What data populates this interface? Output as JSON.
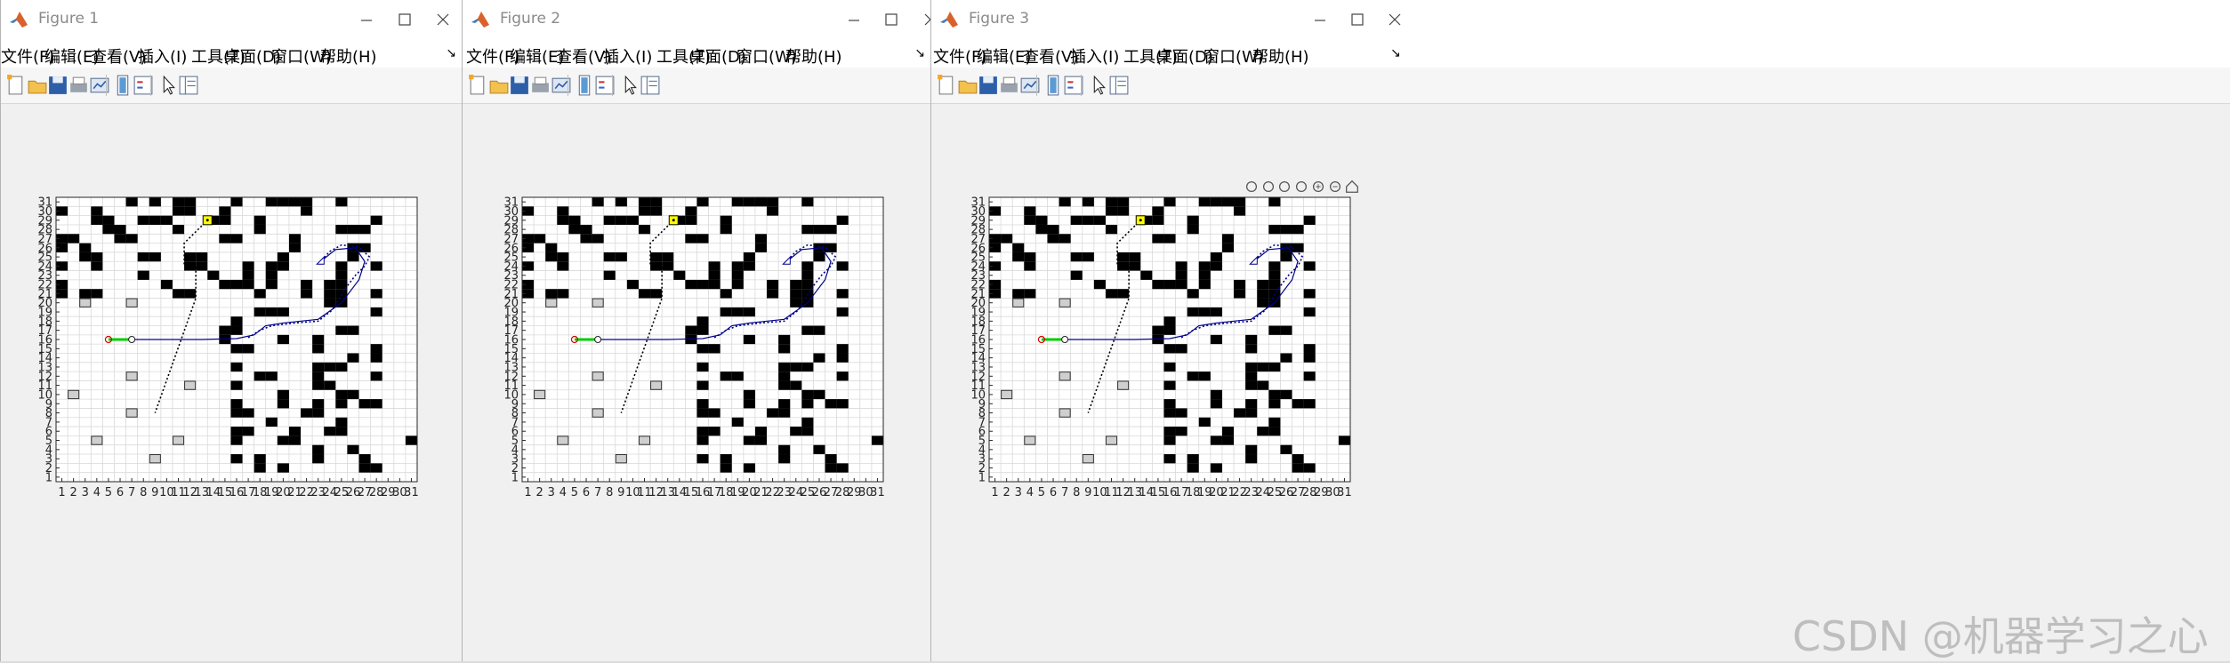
{
  "windows": [
    {
      "title": "Figure 1",
      "show_axes_toolbar": false
    },
    {
      "title": "Figure 2",
      "show_axes_toolbar": false
    },
    {
      "title": "Figure 3",
      "show_axes_toolbar": true
    }
  ],
  "menu": [
    "文件(F)",
    "编辑(E)",
    "查看(V)",
    "插入(I)",
    "工具(T)",
    "桌面(D)",
    "窗口(W)",
    "帮助(H)"
  ],
  "toolbar_icons": [
    "new-figure-icon",
    "open-file-icon",
    "save-icon",
    "print-icon",
    "link-plot-icon",
    "colorbar-icon",
    "legend-icon",
    "edit-plot-icon",
    "property-inspector-icon"
  ],
  "axes_toolbar_icons": [
    "brush-icon",
    "data-tips-icon",
    "export-icon",
    "pan-icon",
    "zoom-in-icon",
    "zoom-out-icon",
    "home-icon"
  ],
  "watermark": "CSDN @机器学习之心",
  "colors": {
    "obstacle": "#000000",
    "grid": "#d9d9d9",
    "gray_obstacle": "#cfcfcf",
    "path": "#000000",
    "trajectory": "#00008b",
    "start_arrow": "#00cc00",
    "goal_box": "#ffff00"
  },
  "chart_data": {
    "type": "grid-map",
    "x_ticks": [
      "1",
      "2",
      "3",
      "4",
      "5",
      "6",
      "7",
      "8",
      "9",
      "10",
      "11",
      "12",
      "13",
      "14",
      "15",
      "16",
      "17",
      "18",
      "19",
      "20",
      "21",
      "22",
      "23",
      "24",
      "25",
      "26",
      "27",
      "28",
      "29",
      "30",
      "31"
    ],
    "y_ticks": [
      "1",
      "2",
      "3",
      "4",
      "5",
      "6",
      "7",
      "8",
      "9",
      "10",
      "11",
      "12",
      "13",
      "14",
      "15",
      "16",
      "17",
      "18",
      "19",
      "20",
      "21",
      "22",
      "23",
      "24",
      "25",
      "26",
      "27",
      "28",
      "29",
      "30",
      "31"
    ],
    "xlim": [
      0.5,
      31.5
    ],
    "ylim": [
      0.5,
      31.5
    ],
    "grid": true,
    "obstacles": [
      [
        7,
        31
      ],
      [
        9,
        31
      ],
      [
        11,
        31
      ],
      [
        12,
        31
      ],
      [
        16,
        31
      ],
      [
        19,
        31
      ],
      [
        20,
        31
      ],
      [
        21,
        31
      ],
      [
        22,
        31
      ],
      [
        25,
        31
      ],
      [
        1,
        30
      ],
      [
        4,
        30
      ],
      [
        11,
        30
      ],
      [
        12,
        30
      ],
      [
        15,
        30
      ],
      [
        22,
        30
      ],
      [
        4,
        29
      ],
      [
        5,
        29
      ],
      [
        8,
        29
      ],
      [
        9,
        29
      ],
      [
        10,
        29
      ],
      [
        14,
        29
      ],
      [
        15,
        29
      ],
      [
        18,
        29
      ],
      [
        28,
        29
      ],
      [
        5,
        28
      ],
      [
        6,
        28
      ],
      [
        11,
        28
      ],
      [
        18,
        28
      ],
      [
        25,
        28
      ],
      [
        26,
        28
      ],
      [
        27,
        28
      ],
      [
        1,
        27
      ],
      [
        2,
        27
      ],
      [
        6,
        27
      ],
      [
        7,
        27
      ],
      [
        15,
        27
      ],
      [
        16,
        27
      ],
      [
        21,
        27
      ],
      [
        1,
        26
      ],
      [
        3,
        26
      ],
      [
        21,
        26
      ],
      [
        26,
        26
      ],
      [
        27,
        26
      ],
      [
        3,
        25
      ],
      [
        4,
        25
      ],
      [
        8,
        25
      ],
      [
        9,
        25
      ],
      [
        12,
        25
      ],
      [
        13,
        25
      ],
      [
        20,
        25
      ],
      [
        26,
        25
      ],
      [
        1,
        24
      ],
      [
        4,
        24
      ],
      [
        12,
        24
      ],
      [
        13,
        24
      ],
      [
        17,
        24
      ],
      [
        19,
        24
      ],
      [
        20,
        24
      ],
      [
        25,
        24
      ],
      [
        28,
        24
      ],
      [
        8,
        23
      ],
      [
        14,
        23
      ],
      [
        17,
        23
      ],
      [
        19,
        23
      ],
      [
        25,
        23
      ],
      [
        1,
        22
      ],
      [
        10,
        22
      ],
      [
        15,
        22
      ],
      [
        16,
        22
      ],
      [
        17,
        22
      ],
      [
        19,
        22
      ],
      [
        22,
        22
      ],
      [
        24,
        22
      ],
      [
        25,
        22
      ],
      [
        1,
        21
      ],
      [
        3,
        21
      ],
      [
        4,
        21
      ],
      [
        11,
        21
      ],
      [
        12,
        21
      ],
      [
        18,
        21
      ],
      [
        22,
        21
      ],
      [
        24,
        21
      ],
      [
        25,
        21
      ],
      [
        28,
        21
      ],
      [
        24,
        20
      ],
      [
        25,
        20
      ],
      [
        18,
        19
      ],
      [
        19,
        19
      ],
      [
        20,
        19
      ],
      [
        28,
        19
      ],
      [
        16,
        18
      ],
      [
        15,
        17
      ],
      [
        16,
        17
      ],
      [
        25,
        17
      ],
      [
        26,
        17
      ],
      [
        20,
        16
      ],
      [
        15,
        16
      ],
      [
        23,
        16
      ],
      [
        16,
        15
      ],
      [
        17,
        15
      ],
      [
        23,
        15
      ],
      [
        28,
        15
      ],
      [
        26,
        14
      ],
      [
        28,
        14
      ],
      [
        16,
        13
      ],
      [
        23,
        13
      ],
      [
        24,
        13
      ],
      [
        25,
        13
      ],
      [
        18,
        12
      ],
      [
        19,
        12
      ],
      [
        23,
        12
      ],
      [
        28,
        12
      ],
      [
        16,
        11
      ],
      [
        23,
        11
      ],
      [
        24,
        11
      ],
      [
        20,
        10
      ],
      [
        25,
        10
      ],
      [
        26,
        10
      ],
      [
        16,
        9
      ],
      [
        20,
        9
      ],
      [
        23,
        9
      ],
      [
        25,
        9
      ],
      [
        27,
        9
      ],
      [
        28,
        9
      ],
      [
        16,
        8
      ],
      [
        17,
        8
      ],
      [
        22,
        8
      ],
      [
        23,
        8
      ],
      [
        19,
        7
      ],
      [
        25,
        7
      ],
      [
        16,
        6
      ],
      [
        17,
        6
      ],
      [
        21,
        6
      ],
      [
        24,
        6
      ],
      [
        25,
        6
      ],
      [
        16,
        5
      ],
      [
        20,
        5
      ],
      [
        21,
        5
      ],
      [
        31,
        5
      ],
      [
        26,
        4
      ],
      [
        23,
        4
      ],
      [
        16,
        3
      ],
      [
        18,
        3
      ],
      [
        23,
        3
      ],
      [
        27,
        3
      ],
      [
        18,
        2
      ],
      [
        20,
        2
      ],
      [
        27,
        2
      ],
      [
        28,
        2
      ]
    ],
    "gray_obstacles": [
      [
        3,
        20
      ],
      [
        7,
        20
      ],
      [
        2,
        10
      ],
      [
        7,
        12
      ],
      [
        12,
        11
      ],
      [
        7,
        8
      ],
      [
        4,
        5
      ],
      [
        11,
        5
      ],
      [
        9,
        3
      ]
    ],
    "start": [
      5,
      16
    ],
    "start_heading_end": [
      7,
      16
    ],
    "goal": [
      13.5,
      29
    ],
    "planned_path": [
      [
        13.5,
        29
      ],
      [
        11.5,
        26.5
      ],
      [
        11.5,
        24
      ],
      [
        12.5,
        24
      ],
      [
        12.5,
        20.5
      ],
      [
        9,
        8
      ]
    ],
    "trajectory": [
      [
        7,
        16
      ],
      [
        10,
        16
      ],
      [
        13,
        16
      ],
      [
        16,
        16.1
      ],
      [
        17.5,
        16.5
      ],
      [
        18.5,
        17.5
      ],
      [
        20,
        17.8
      ],
      [
        23,
        18.2
      ],
      [
        25,
        20
      ],
      [
        26.5,
        22.5
      ],
      [
        27,
        24.5
      ],
      [
        26.2,
        26
      ],
      [
        24.5,
        25.8
      ],
      [
        23.2,
        24.5
      ]
    ],
    "trajectory_dotted": [
      [
        17,
        16.2
      ],
      [
        18,
        17
      ],
      [
        19,
        17.5
      ],
      [
        21,
        17.8
      ],
      [
        23,
        18
      ],
      [
        24.2,
        19.2
      ],
      [
        25.3,
        21.5
      ],
      [
        26.2,
        23
      ],
      [
        27,
        24
      ],
      [
        27.4,
        25
      ],
      [
        26.5,
        26.1
      ],
      [
        25,
        26.3
      ],
      [
        24,
        25.6
      ],
      [
        23.2,
        24.5
      ]
    ]
  }
}
